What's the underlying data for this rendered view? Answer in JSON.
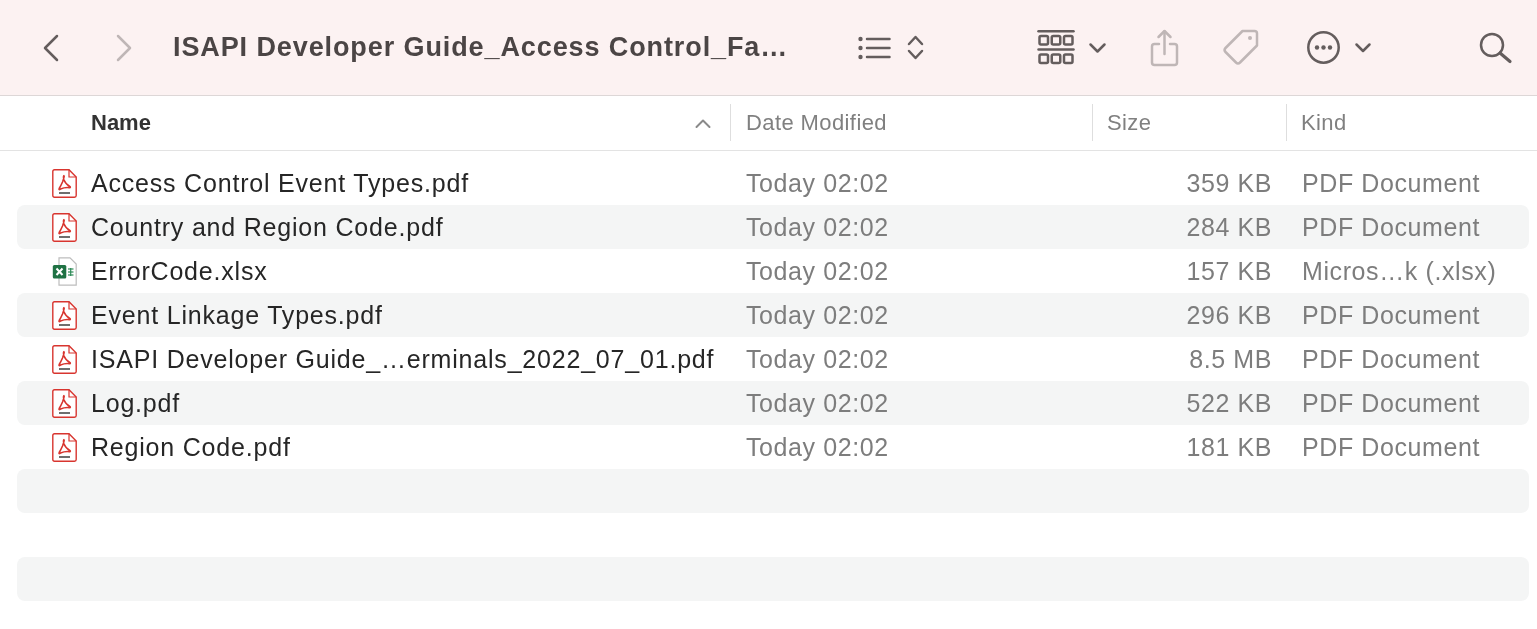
{
  "toolbar": {
    "back": {
      "disabled": false
    },
    "forward": {
      "disabled": true
    },
    "title": "ISAPI Developer Guide_Access Control_Fa…",
    "tools": [
      {
        "kind": "view-list",
        "disabled": false
      },
      {
        "kind": "group",
        "disabled": false
      },
      {
        "kind": "share",
        "disabled": true
      },
      {
        "kind": "tag",
        "disabled": true
      },
      {
        "kind": "more",
        "disabled": false
      },
      {
        "kind": "search",
        "disabled": false
      }
    ]
  },
  "table": {
    "columns": [
      {
        "label": "Name",
        "sorted": true
      },
      {
        "label": "Date Modified",
        "sorted": false
      },
      {
        "label": "Size",
        "sorted": false
      },
      {
        "label": "Kind",
        "sorted": false
      }
    ],
    "rows": [
      {
        "kind": "pdf",
        "name": "Access Control Event Types.pdf",
        "date": "Today 02:02",
        "size": "359 KB",
        "file_kind": "PDF Document",
        "selected": false
      },
      {
        "kind": "pdf",
        "name": "Country and Region Code.pdf",
        "date": "Today 02:02",
        "size": "284 KB",
        "file_kind": "PDF Document",
        "selected": false
      },
      {
        "kind": "xlsx",
        "name": "ErrorCode.xlsx",
        "date": "Today 02:02",
        "size": "157 KB",
        "file_kind": "Micros…k (.xlsx)",
        "selected": false
      },
      {
        "kind": "pdf",
        "name": "Event Linkage Types.pdf",
        "date": "Today 02:02",
        "size": "296 KB",
        "file_kind": "PDF Document",
        "selected": false
      },
      {
        "kind": "pdf",
        "name": "ISAPI Developer Guide_…erminals_2022_07_01.pdf",
        "date": "Today 02:02",
        "size": "8.5 MB",
        "file_kind": "PDF Document",
        "selected": false
      },
      {
        "kind": "pdf",
        "name": "Log.pdf",
        "date": "Today 02:02",
        "size": "522 KB",
        "file_kind": "PDF Document",
        "selected": false
      },
      {
        "kind": "pdf",
        "name": "Region Code.pdf",
        "date": "Today 02:02",
        "size": "181 KB",
        "file_kind": "PDF Document",
        "selected": false
      }
    ]
  }
}
